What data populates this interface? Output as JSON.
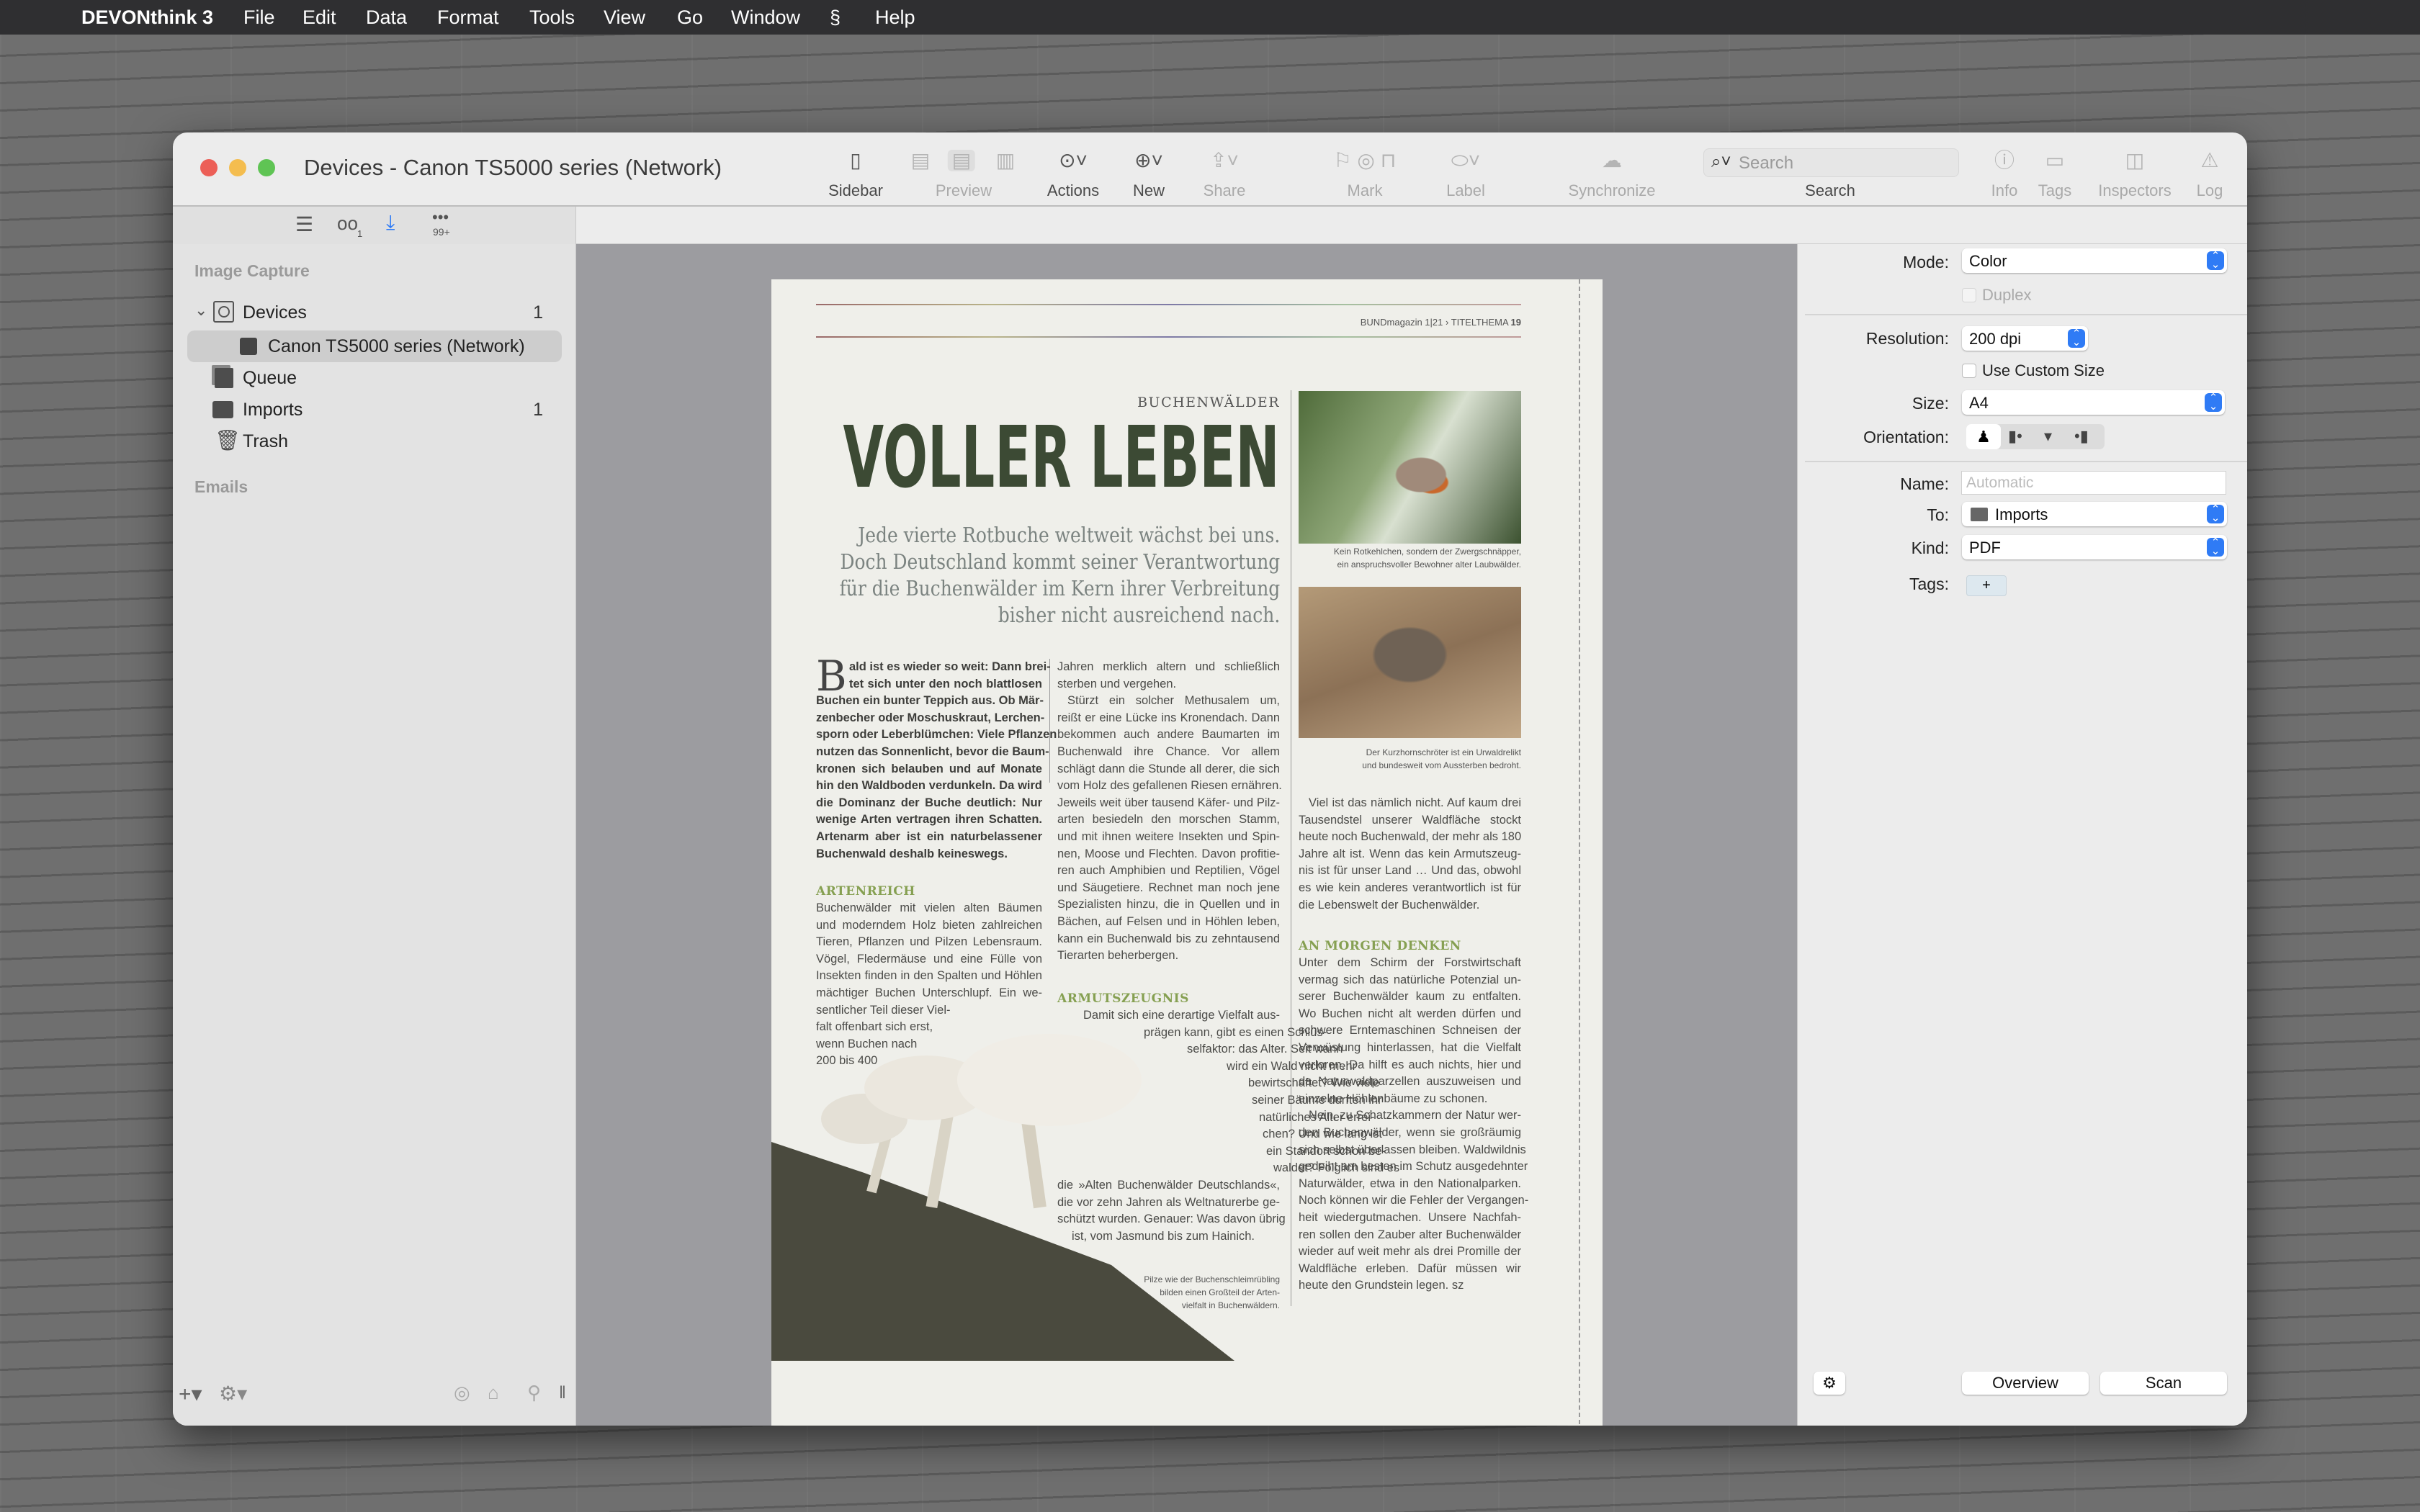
{
  "menubar": {
    "app": "DEVONthink 3",
    "items": [
      "File",
      "Edit",
      "Data",
      "Format",
      "Tools",
      "View",
      "Go",
      "Window",
      "Help"
    ]
  },
  "window": {
    "title": "Devices - Canon TS5000 series (Network)"
  },
  "toolbar": {
    "sidebar": "Sidebar",
    "preview": "Preview",
    "actions": "Actions",
    "new": "New",
    "share": "Share",
    "mark": "Mark",
    "label": "Label",
    "synchronize": "Synchronize",
    "search": "Search",
    "search_placeholder": "Search",
    "info": "Info",
    "tags": "Tags",
    "inspectors": "Inspectors",
    "log": "Log"
  },
  "subbar": {
    "watched_count": "1",
    "items_count": "99+"
  },
  "sidebar": {
    "section1": "Image Capture",
    "devices": {
      "label": "Devices",
      "count": "1"
    },
    "device": {
      "label": "Canon TS5000 series (Network)"
    },
    "queue": {
      "label": "Queue"
    },
    "imports": {
      "label": "Imports",
      "count": "1"
    },
    "trash": {
      "label": "Trash"
    },
    "section2": "Emails"
  },
  "inspector": {
    "mode_label": "Mode:",
    "mode": "Color",
    "duplex": "Duplex",
    "resolution_label": "Resolution:",
    "resolution": "200 dpi",
    "custom_size": "Use Custom Size",
    "size_label": "Size:",
    "size": "A4",
    "orientation_label": "Orientation:",
    "name_label": "Name:",
    "name_placeholder": "Automatic",
    "to_label": "To:",
    "to": "Imports",
    "kind_label": "Kind:",
    "kind": "PDF",
    "tags_label": "Tags:",
    "tags_add": "+",
    "overview": "Overview",
    "scan": "Scan"
  },
  "article": {
    "running_head": "BUNDmagazin 1|21 › TITELTHEMA",
    "page_number": "19",
    "kicker": "BUCHENWÄLDER",
    "headline": "VOLLER LEBEN",
    "deck": [
      "Jede vierte Rotbuche weltweit wächst bei uns.",
      "Doch Deutschland kommt seiner Verantwortung",
      "für die Buchenwälder im Kern ihrer Verbreitung",
      "bisher nicht ausreichend nach."
    ],
    "dropcap": "B",
    "col1_lead": [
      "ald ist es wieder so weit: Dann brei-",
      "tet sich unter den noch blattlosen",
      "Buchen ein bunter Teppich aus. Ob Mär-",
      "zenbecher oder Moschuskraut, Lerchen-",
      "sporn oder Leberblümchen: Viele Pflanzen",
      "nutzen das Sonnenlicht, bevor die Baum-",
      "kronen sich belauben und auf Monate",
      "hin den Waldboden verdunkeln. Da wird",
      "die Dominanz der Buche deutlich: Nur",
      "wenige Arten vertragen ihren Schatten.",
      "Artenarm aber ist ein naturbelassener",
      "Buchenwald deshalb keineswegs."
    ],
    "heading1": "ARTENREICH",
    "col1_p2": [
      "Buchenwälder mit vielen alten Bäumen",
      "und moderndem Holz bieten zahlreichen",
      "Tieren, Pflanzen und Pilzen Lebensraum.",
      "Vögel, Fledermäuse und eine Fülle von",
      "Insekten finden in den Spalten und Höhlen",
      "mächtiger Buchen Unterschlupf. Ein we-",
      "sentlicher Teil dieser Viel-",
      "falt offenbart sich erst,",
      "wenn Buchen nach",
      "200 bis 400"
    ],
    "col2_p1": [
      "Jahren merklich altern und schließlich",
      "sterben und vergehen."
    ],
    "col2_p2": [
      "   Stürzt ein solcher Methusalem um,",
      "reißt er eine Lücke ins Kronendach. Dann",
      "bekommen auch andere Baumarten im",
      "Buchenwald ihre Chance. Vor allem",
      "schlägt dann die Stunde all derer, die sich",
      "vom Holz des gefallenen Riesen ernähren.",
      "Jeweils weit über tausend Käfer- und Pilz-",
      "arten besiedeln den morschen Stamm,",
      "und mit ihnen weitere Insekten und Spin-",
      "nen, Moose und Flechten. Davon profitie-",
      "ren auch Amphibien und Reptilien, Vögel",
      "und Säugetiere. Rechnet man noch jene",
      "Spezialisten hinzu, die in Quellen und in",
      "Bächen, auf Felsen und in Höhlen leben,",
      "kann ein Buchenwald bis zu zehntausend",
      "Tierarten beherbergen."
    ],
    "heading2": "ARMUTSZEUGNIS",
    "col2_p3": [
      "Damit sich eine derartige Vielfalt aus-",
      "prägen kann, gibt es einen Schlüs-",
      "selfaktor: das Alter. Seit wann",
      "wird ein Wald nicht mehr",
      "bewirtschaftet? Wie viele",
      "seiner Bäume durften ihr",
      "natürliches Alter errei-",
      "chen? Und wie lang ist",
      "ein Standort schon be-",
      "waldet? Folglich sind es",
      "die »Alten Buchenwälder Deutschlands«,",
      "die vor zehn Jahren als Weltnaturerbe ge-",
      "schützt wurden. Genauer: Was davon übrig",
      "ist, vom Jasmund bis zum Hainich."
    ],
    "caption_mushroom": [
      "Pilze wie der Buchenschleimrübling",
      "bilden einen Großteil der Arten-",
      "vielfalt in Buchenwäldern."
    ],
    "caption_bird": [
      "Kein Rotkehlchen, sondern der Zwergschnäpper,",
      "ein anspruchsvoller Bewohner alter Laubwälder."
    ],
    "caption_beetle": [
      "Der Kurzhornschröter ist ein Urwaldrelikt",
      "und bundesweit vom Aussterben bedroht."
    ],
    "col3_p1": [
      "   Viel ist das nämlich nicht. Auf kaum drei",
      "Tausendstel unserer Waldfläche stockt",
      "heute noch Buchenwald, der mehr als 180",
      "Jahre alt ist. Wenn das kein Armutszeug-",
      "nis ist für unser Land … Und das, obwohl",
      "es wie kein anderes verantwortlich ist für",
      "die Lebenswelt der Buchenwälder."
    ],
    "heading3": "AN MORGEN DENKEN",
    "col3_p2": [
      "Unter dem Schirm der Forstwirtschaft",
      "vermag sich das natürliche Potenzial un-",
      "serer Buchenwälder kaum zu entfalten.",
      "Wo Buchen nicht alt werden dürfen und",
      "schwere Erntemaschinen Schneisen der",
      "Verwüstung hinterlassen, hat die Vielfalt",
      "verloren. Da hilft es auch nichts, hier und",
      "da Naturwaldparzellen auszuweisen und",
      "einzelne Höhlenbäume zu schonen."
    ],
    "col3_p3": [
      "   Nein, zu Schatzkammern der Natur wer-",
      "den Buchenwälder, wenn sie großräumig",
      "sich selbst überlassen bleiben. Waldwildnis",
      "gedeiht am besten im Schutz ausgedehnter",
      "Naturwälder, etwa in den Nationalparken.",
      "Noch können wir die Fehler der Vergangen-",
      "heit wiedergutmachen. Unsere Nachfah-",
      "ren sollen den Zauber alter Buchenwälder",
      "wieder auf weit mehr als drei Promille der",
      "Waldfläche erleben. Dafür müssen wir",
      "heute den Grundstein legen.              sz"
    ]
  },
  "colors": {
    "accent": "#2f7bf5",
    "close": "#ec5f57",
    "minimize": "#f4bd4f",
    "zoom": "#5fc454",
    "headline": "#3c4a34",
    "subheading": "#86a052"
  }
}
